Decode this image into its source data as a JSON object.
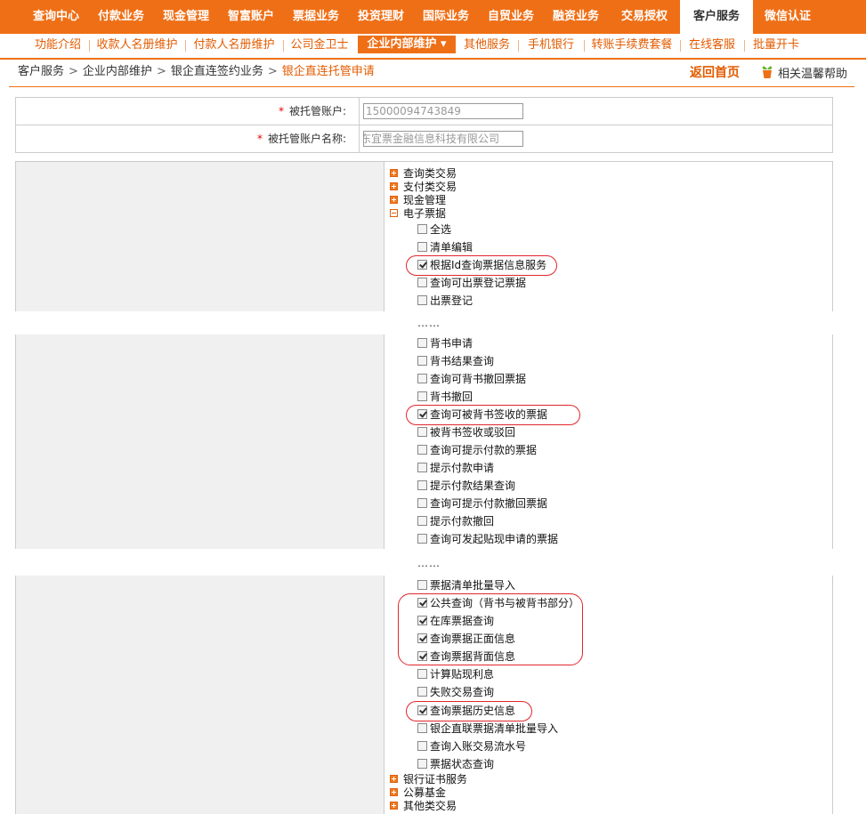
{
  "top_nav": [
    "查询中心",
    "付款业务",
    "现金管理",
    "智富账户",
    "票据业务",
    "投资理财",
    "国际业务",
    "自贸业务",
    "融资业务",
    "交易授权",
    "客户服务",
    "微信认证"
  ],
  "sub_nav": [
    "功能介绍",
    "收款人名册维护",
    "付款人名册维护",
    "公司金卫士",
    "企业内部维护 ▾",
    "其他服务",
    "手机银行",
    "转账手续费套餐",
    "在线客服",
    "批量开卡"
  ],
  "breadcrumb": {
    "items": [
      "客户服务",
      "企业内部维护",
      "银企直连签约业务"
    ],
    "current": "银企直连托管申请",
    "separator": ">"
  },
  "header_links": {
    "home": "返回首页",
    "help": "相关温馨帮助"
  },
  "form": {
    "required_mark": "*",
    "account_label": "被托管账户:",
    "account_value": "15000094743849",
    "name_label": "被托管账户名称:",
    "name_value": "东宜票金融信息科技有限公司"
  },
  "tree": {
    "top_nodes": [
      "查询类交易",
      "支付类交易",
      "现金管理",
      "电子票据"
    ],
    "bottom_nodes": [
      "银行证书服务",
      "公募基金",
      "其他类交易"
    ],
    "dots": "……",
    "group1": [
      {
        "label": "全选",
        "checked": false
      },
      {
        "label": "清单编辑",
        "checked": false
      },
      {
        "label": "根据Id查询票据信息服务",
        "checked": true
      },
      {
        "label": "查询可出票登记票据",
        "checked": false
      },
      {
        "label": "出票登记",
        "checked": false
      }
    ],
    "group2": [
      {
        "label": "背书申请",
        "checked": false
      },
      {
        "label": "背书结果查询",
        "checked": false
      },
      {
        "label": "查询可背书撤回票据",
        "checked": false
      },
      {
        "label": "背书撤回",
        "checked": false
      },
      {
        "label": "查询可被背书签收的票据",
        "checked": true
      },
      {
        "label": "被背书签收或驳回",
        "checked": false
      },
      {
        "label": "查询可提示付款的票据",
        "checked": false
      },
      {
        "label": "提示付款申请",
        "checked": false
      },
      {
        "label": "提示付款结果查询",
        "checked": false
      },
      {
        "label": "查询可提示付款撤回票据",
        "checked": false
      },
      {
        "label": "提示付款撤回",
        "checked": false
      },
      {
        "label": "查询可发起贴现申请的票据",
        "checked": false
      }
    ],
    "group3": [
      {
        "label": "票据清单批量导入",
        "checked": false
      },
      {
        "label": "公共查询（背书与被背书部分）",
        "checked": true
      },
      {
        "label": "在库票据查询",
        "checked": true
      },
      {
        "label": "查询票据正面信息",
        "checked": true
      },
      {
        "label": "查询票据背面信息",
        "checked": true
      },
      {
        "label": "计算贴现利息",
        "checked": false
      },
      {
        "label": "失败交易查询",
        "checked": false
      },
      {
        "label": "查询票据历史信息",
        "checked": true
      },
      {
        "label": "银企直联票据清单批量导入",
        "checked": false
      },
      {
        "label": "查询入账交易流水号",
        "checked": false
      },
      {
        "label": "票据状态查询",
        "checked": false
      }
    ]
  },
  "colors": {
    "brand_orange": "#ef6f16",
    "highlight_red": "#e0262b"
  }
}
